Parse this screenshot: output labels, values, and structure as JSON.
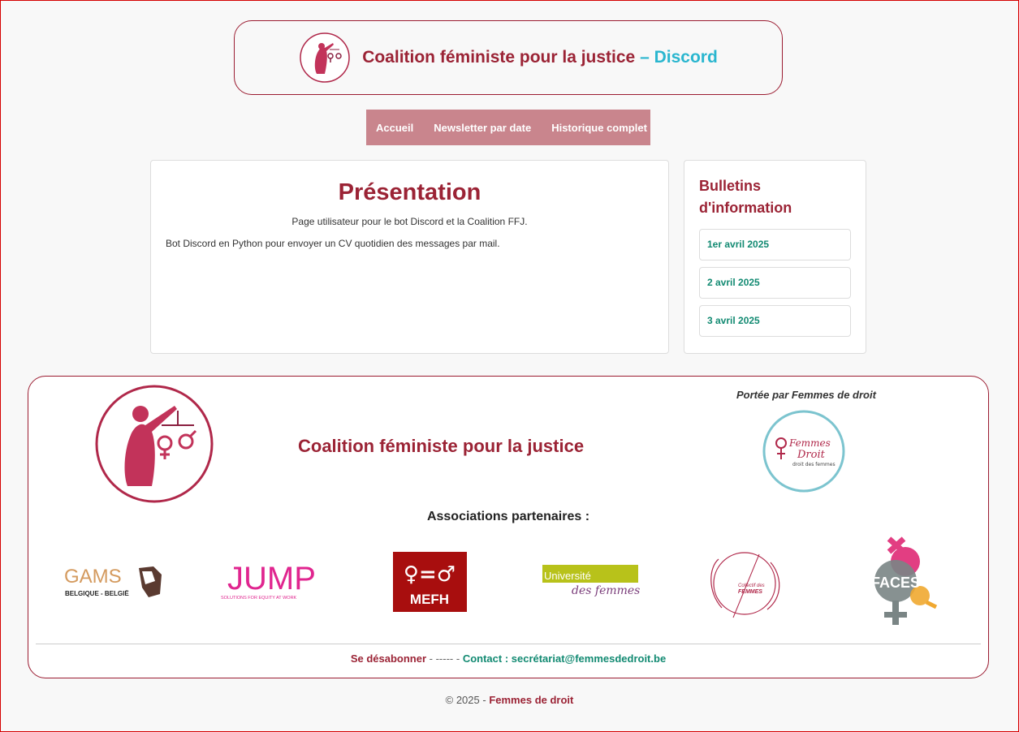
{
  "header": {
    "title": "Coalition féministe pour la justice",
    "title_accent": "– Discord",
    "logo_icon": "justice-woman-logo-icon"
  },
  "nav": {
    "items": [
      {
        "label": "Accueil"
      },
      {
        "label": "Newsletter par date"
      },
      {
        "label": "Historique complet"
      }
    ],
    "background": "#c9858d"
  },
  "main": {
    "heading": "Présentation",
    "subtitle": "Page utilisateur pour le bot Discord et la Coalition FFJ.",
    "description": "Bot Discord en Python pour envoyer un CV quotidien des messages par mail."
  },
  "sidebar": {
    "heading": "Bulletins d'information",
    "bulletins": [
      {
        "label": "1er avril 2025"
      },
      {
        "label": "2 avril 2025"
      },
      {
        "label": "3 avril 2025"
      }
    ]
  },
  "footer": {
    "title": "Coalition féministe pour la justice",
    "portee": "Portée par Femmes de droit",
    "fdd_logo_text": "Femmes de Droit",
    "fdd_logo_sub": "droit des femmes",
    "associations_title": "Associations partenaires :",
    "partners": [
      {
        "name": "GAMS",
        "sub": "BELGIQUE - BELGIË"
      },
      {
        "name": "JUMP",
        "sub": "SOLUTIONS FOR EQUITY AT WORK"
      },
      {
        "name": "MEFH",
        "symbol": "♀=♂"
      },
      {
        "name": "Université",
        "sub": "des femmes"
      },
      {
        "name": "Collectif des",
        "sub": "FEMMES"
      },
      {
        "name": "FACES"
      }
    ],
    "unsubscribe": "Se désabonner",
    "separator": "- ----- -",
    "contact": "Contact : secrétariat@femmesdedroit.be"
  },
  "copyright": {
    "prefix": "© 2025 -",
    "org": "Femmes de droit"
  },
  "colors": {
    "brand": "#9b2335",
    "accent": "#2ab6cf",
    "link": "#128a72"
  }
}
